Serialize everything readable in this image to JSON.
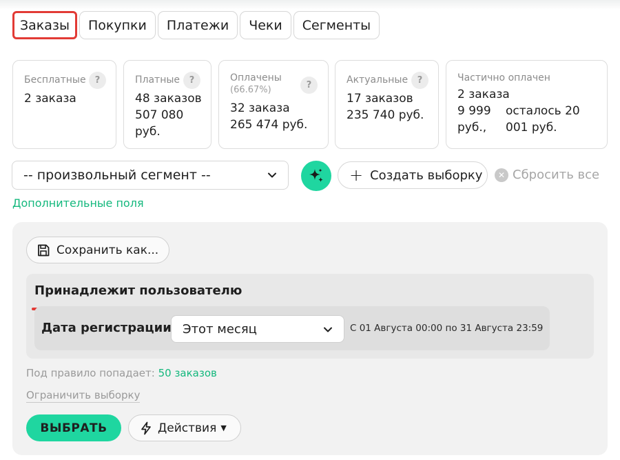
{
  "tabs": [
    {
      "label": "Заказы"
    },
    {
      "label": "Покупки"
    },
    {
      "label": "Платежи"
    },
    {
      "label": "Чеки"
    },
    {
      "label": "Сегменты"
    }
  ],
  "stats": {
    "free": {
      "label": "Бесплатные",
      "value": "2 заказа"
    },
    "paid": {
      "label": "Платные",
      "count": "48 заказов",
      "amount": "507 080",
      "currency": "руб."
    },
    "settled": {
      "label": "Оплачены",
      "percent": "(66.67%)",
      "count": "32 заказа",
      "amount": "265 474 руб."
    },
    "actual": {
      "label": "Актуальные",
      "count": "17 заказов",
      "amount": "235 740 руб."
    },
    "partial": {
      "label": "Частично оплачен",
      "count": "2 заказа",
      "paid_amount": "9 999",
      "paid_currency": "руб.,",
      "remaining_a": "осталось 20",
      "remaining_b": "001 руб."
    },
    "help_symbol": "?"
  },
  "filters": {
    "segment_value": "-- произвольный сегмент --",
    "create_label": "Создать выборку",
    "reset_label": "Сбросить все",
    "extra_fields_label": "Дополнительные поля"
  },
  "builder": {
    "save_as_label": "Сохранить как...",
    "rule_title": "Принадлежит пользователю",
    "condition_label": "Дата регистрации",
    "period_value": "Этот месяц",
    "range_text": "С 01 Августа 00:00 по 31 Августа 23:59",
    "matches_prefix": "Под правило попадает:",
    "matches_count": "50 заказов",
    "limit_label": "Ограничить выборку",
    "choose_label": "ВЫБРАТЬ",
    "actions_label": "Действия"
  },
  "colors": {
    "accent": "#1fd6a0",
    "link": "#14b87d",
    "highlight": "#e23a35"
  },
  "icons": {
    "magic": "sparkle-icon",
    "save": "floppy-disk-icon",
    "actions": "lightning-icon",
    "dropdown": "chevron-down-icon",
    "reset": "close-circle-icon",
    "add": "plus-icon"
  }
}
